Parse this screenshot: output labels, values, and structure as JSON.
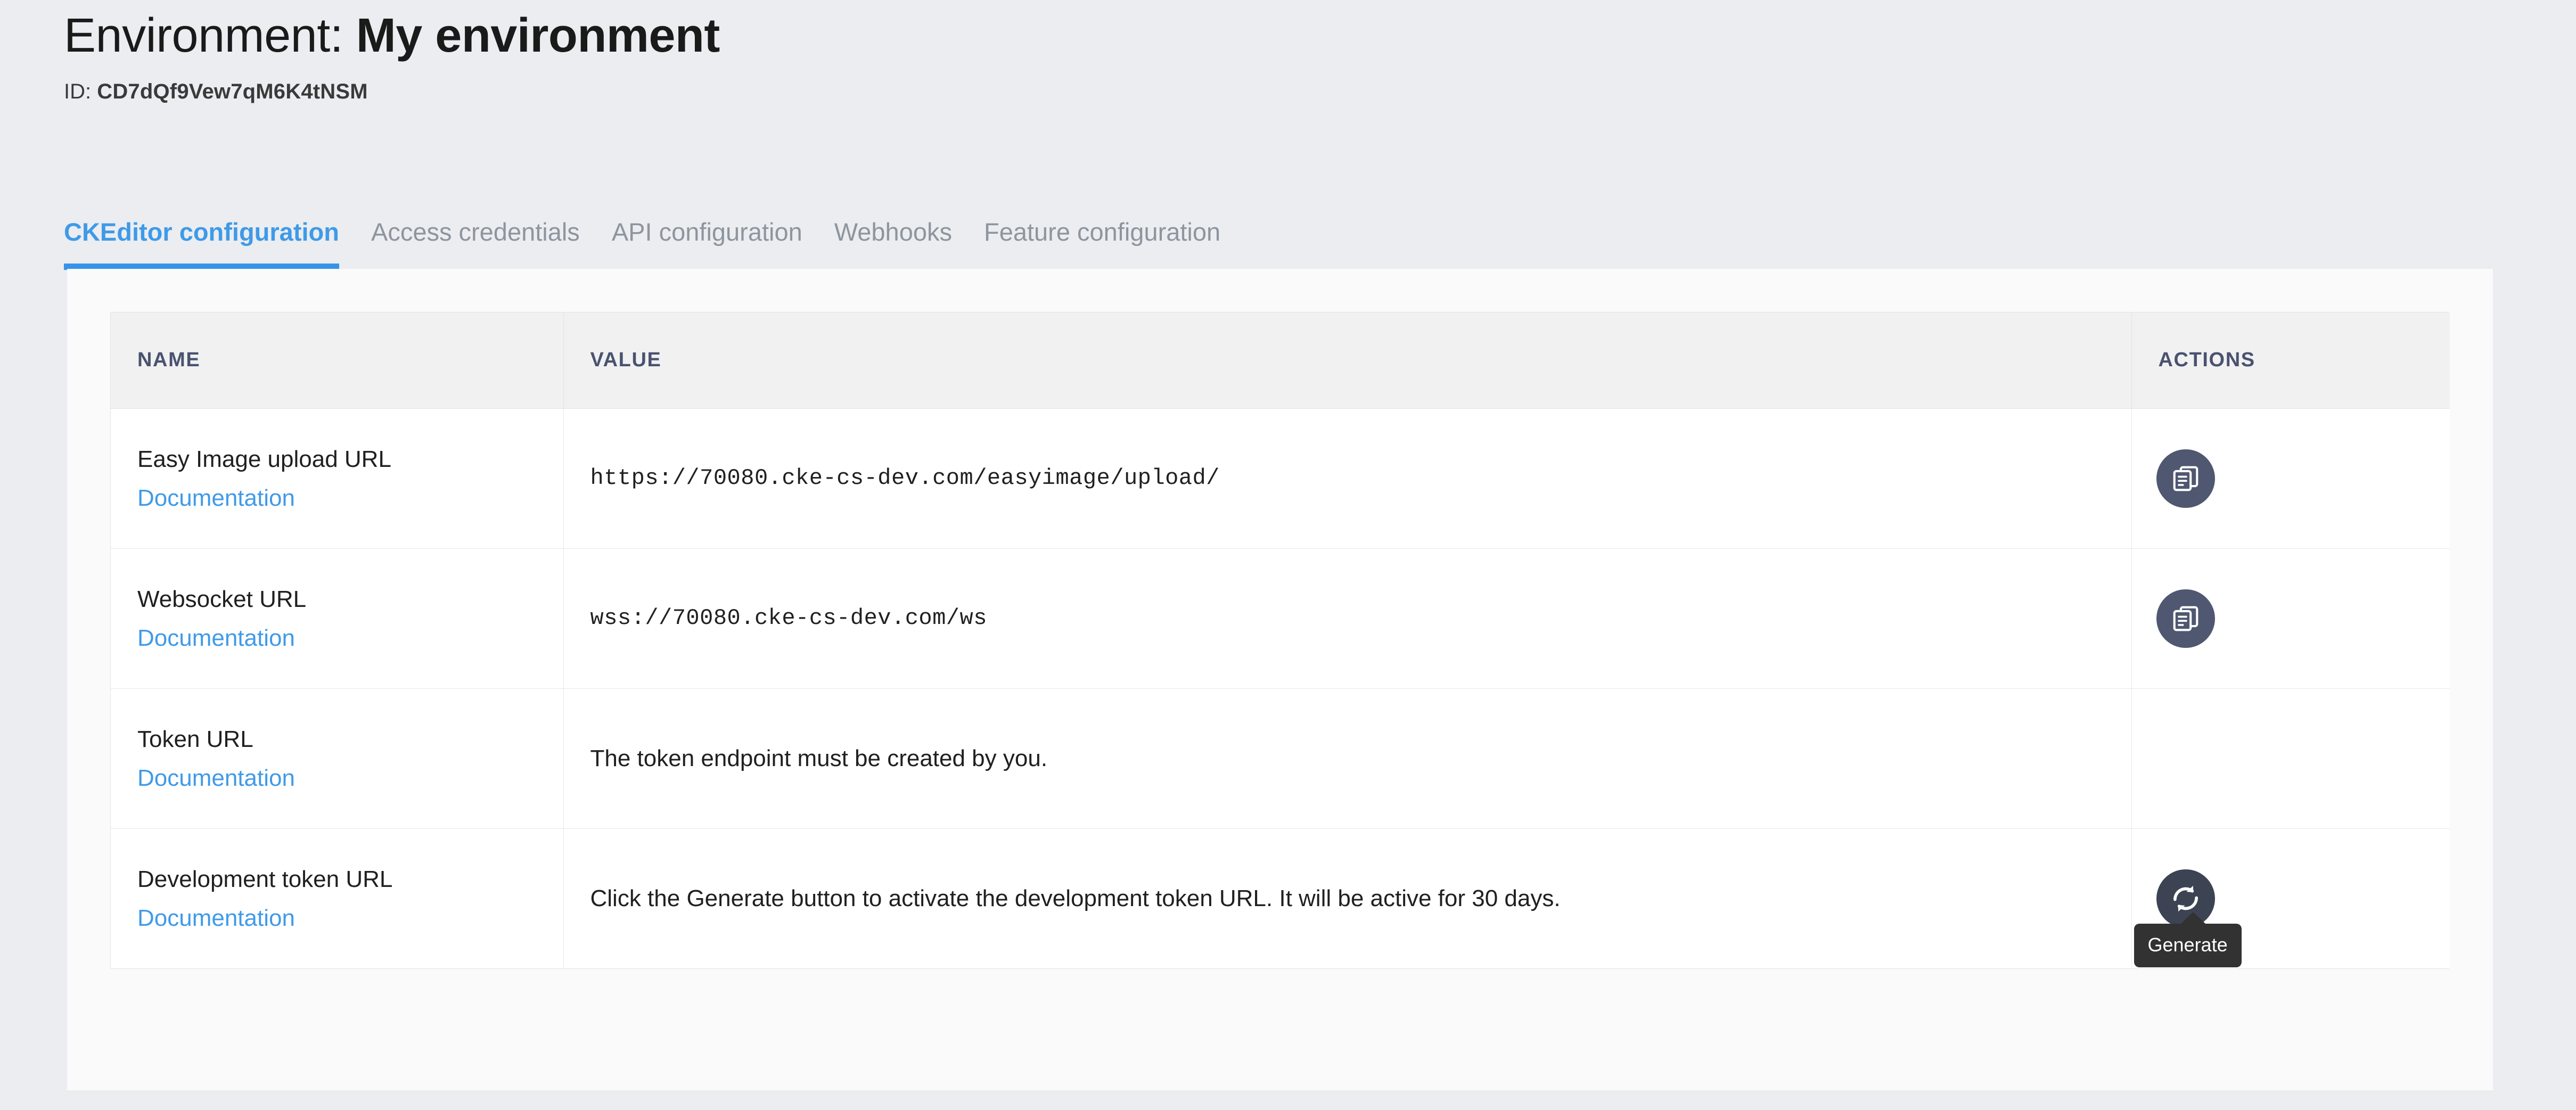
{
  "header": {
    "title_prefix": "Environment: ",
    "title_name": "My environment",
    "id_label": "ID: ",
    "id_value": "CD7dQf9Vew7qM6K4tNSM"
  },
  "tabs": [
    {
      "label": "CKEditor configuration",
      "active": true
    },
    {
      "label": "Access credentials",
      "active": false
    },
    {
      "label": "API configuration",
      "active": false
    },
    {
      "label": "Webhooks",
      "active": false
    },
    {
      "label": "Feature configuration",
      "active": false
    }
  ],
  "table": {
    "columns": [
      "NAME",
      "VALUE",
      "ACTIONS"
    ],
    "doc_link_label": "Documentation",
    "rows": [
      {
        "name": "Easy Image upload URL",
        "doc": "Documentation",
        "value": "https://70080.cke-cs-dev.com/easyimage/upload/",
        "value_mono": true,
        "action": "copy"
      },
      {
        "name": "Websocket URL",
        "doc": "Documentation",
        "value": "wss://70080.cke-cs-dev.com/ws",
        "value_mono": true,
        "action": "copy"
      },
      {
        "name": "Token URL",
        "doc": "Documentation",
        "value": "The token endpoint must be created by you.",
        "value_mono": false,
        "action": "none"
      },
      {
        "name": "Development token URL",
        "doc": "Documentation",
        "value": "Click the Generate button to activate the development token URL. It will be active for 30 days.",
        "value_mono": false,
        "action": "generate"
      }
    ]
  },
  "tooltip": {
    "label": "Generate"
  },
  "colors": {
    "page_background": "#ebedf0",
    "card_background": "#fafafa",
    "accent_blue": "#3693e8",
    "link_blue": "#3f9ae8",
    "header_text": "#4a5270",
    "button_circle": "#4f5870",
    "button_circle_dark": "#3c4353",
    "tooltip_background": "#323232"
  }
}
